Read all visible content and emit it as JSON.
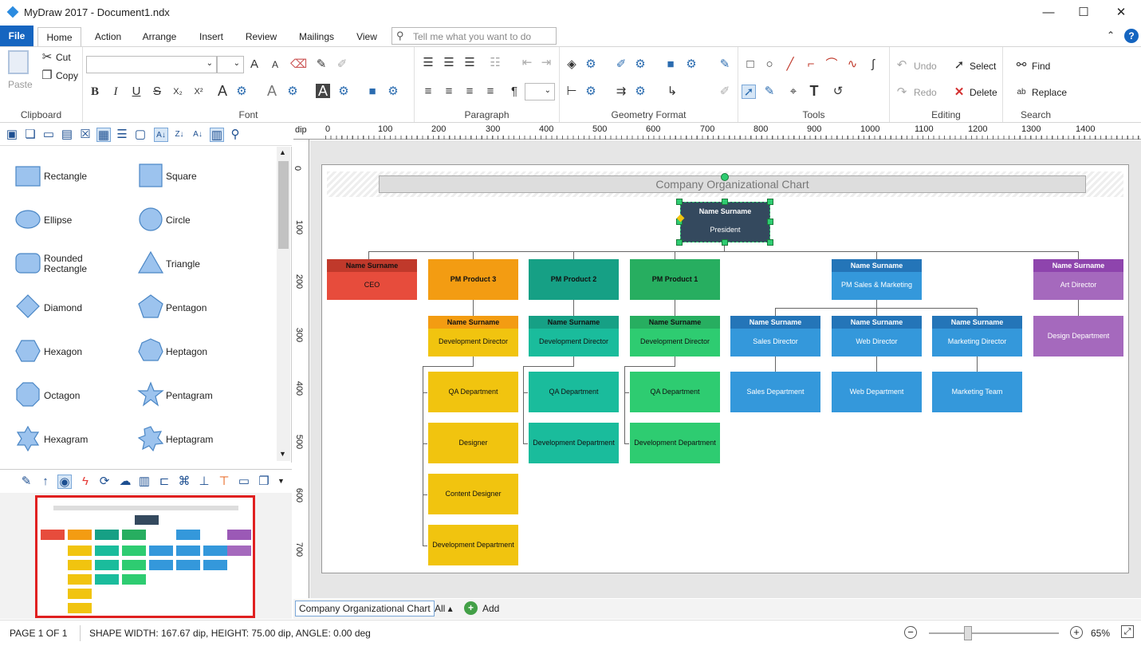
{
  "window": {
    "title": "MyDraw 2017 - Document1.ndx",
    "min": "—",
    "max": "☐",
    "close": "✕"
  },
  "tabs": [
    "File",
    "Home",
    "Action",
    "Arrange",
    "Insert",
    "Review",
    "Mailings",
    "View"
  ],
  "tellme": "Tell me what you want to do",
  "ribbon": {
    "clipboard": {
      "label": "Clipboard",
      "paste": "Paste",
      "cut": "Cut",
      "copy": "Copy"
    },
    "font": {
      "label": "Font",
      "bold": "B",
      "italic": "I",
      "underline": "U",
      "strike": "S",
      "sub": "X₂",
      "sup": "X²"
    },
    "paragraph": {
      "label": "Paragraph"
    },
    "geometry": {
      "label": "Geometry Format"
    },
    "tools": {
      "label": "Tools"
    },
    "editing": {
      "label": "Editing",
      "undo": "Undo",
      "redo": "Redo",
      "select": "Select",
      "delete": "Delete"
    },
    "search": {
      "label": "Search",
      "find": "Find",
      "replace": "Replace"
    }
  },
  "shapes": [
    {
      "name": "Rectangle",
      "kind": "rect"
    },
    {
      "name": "Square",
      "kind": "square"
    },
    {
      "name": "Ellipse",
      "kind": "ellipse"
    },
    {
      "name": "Circle",
      "kind": "circle"
    },
    {
      "name": "Rounded Rectangle",
      "kind": "rrect"
    },
    {
      "name": "Triangle",
      "kind": "triangle"
    },
    {
      "name": "Diamond",
      "kind": "diamond"
    },
    {
      "name": "Pentagon",
      "kind": "pentagon"
    },
    {
      "name": "Hexagon",
      "kind": "hexagon"
    },
    {
      "name": "Heptagon",
      "kind": "heptagon"
    },
    {
      "name": "Octagon",
      "kind": "octagon"
    },
    {
      "name": "Pentagram",
      "kind": "pentagram"
    },
    {
      "name": "Hexagram",
      "kind": "hexagram"
    },
    {
      "name": "Heptagram",
      "kind": "heptagram"
    }
  ],
  "ruler": {
    "unit": "dip",
    "top": [
      "0",
      "100",
      "200",
      "300",
      "400",
      "500",
      "600",
      "700",
      "800",
      "900",
      "1000",
      "1100",
      "1200",
      "1300",
      "1400"
    ],
    "left": [
      "0",
      "100",
      "200",
      "300",
      "400",
      "500",
      "600",
      "700"
    ]
  },
  "chart": {
    "title": "Company Organizational Chart",
    "president": {
      "name": "Name Surname",
      "role": "President"
    },
    "ceo": {
      "name": "Name Surname",
      "role": "CEO",
      "color": "#e74c3c",
      "hcolor": "#c0392b"
    },
    "pm3": "PM Product 3",
    "pm2": "PM Product 2",
    "pm1": "PM Product 1",
    "pmsales": {
      "name": "Name Surname",
      "role": "PM Sales & Marketing"
    },
    "art": {
      "name": "Name Surname",
      "role": "Art Director"
    },
    "dev3": {
      "name": "Name Surname",
      "role": "Development Director"
    },
    "dev2": {
      "name": "Name Surname",
      "role": "Development Director"
    },
    "dev1": {
      "name": "Name Surname",
      "role": "Development Director"
    },
    "salesdir": {
      "name": "Name Surname",
      "role": "Sales Director"
    },
    "webdir": {
      "name": "Name Surname",
      "role": "Web Director"
    },
    "mktdir": {
      "name": "Name Surname",
      "role": "Marketing Director"
    },
    "design": "Design Department",
    "qa3": "QA Department",
    "designer": "Designer",
    "content": "Content Designer",
    "devdept3": "Development Department",
    "qa2": "QA Department",
    "devdept2": "Development Department",
    "qa1": "QA Department",
    "devdept1": "Development Department",
    "salesdept": "Sales Department",
    "webdept": "Web Department",
    "mktteam": "Marketing Team"
  },
  "pagetabs": {
    "current": "Company Organizational Chart",
    "all": "All ▴",
    "add": "Add"
  },
  "status": {
    "page": "PAGE 1 OF 1",
    "shape": "SHAPE WIDTH: 167.67 dip, HEIGHT: 75.00 dip, ANGLE: 0.00 deg",
    "zoom": "65%"
  }
}
